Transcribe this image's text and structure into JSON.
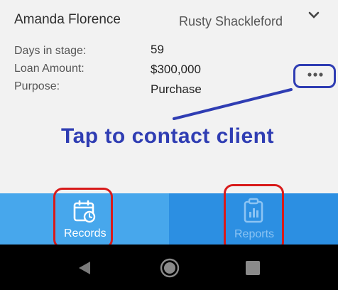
{
  "card": {
    "client_name": "Amanda Florence",
    "agent_name": "Rusty Shackleford",
    "fields": [
      {
        "label": "Days in stage:",
        "value": "59"
      },
      {
        "label": "Loan Amount:",
        "value": "$300,000"
      },
      {
        "label": "Purpose:",
        "value": "Purchase"
      }
    ]
  },
  "annotation": {
    "text": "Tap to contact client",
    "color": "#2f3db3",
    "highlight_color": "#d81b1b"
  },
  "bottom_nav": {
    "items": [
      {
        "label": "Records",
        "icon": "calendar-clock-icon",
        "active": true
      },
      {
        "label": "Reports",
        "icon": "clipboard-chart-icon",
        "active": false
      }
    ],
    "colors": {
      "records_bg": "#47a7ec",
      "reports_bg": "#2c8fe2",
      "inactive_text": "#8cc4f3"
    }
  },
  "system_nav": {
    "buttons": [
      "back-icon",
      "home-icon",
      "recents-icon"
    ]
  }
}
